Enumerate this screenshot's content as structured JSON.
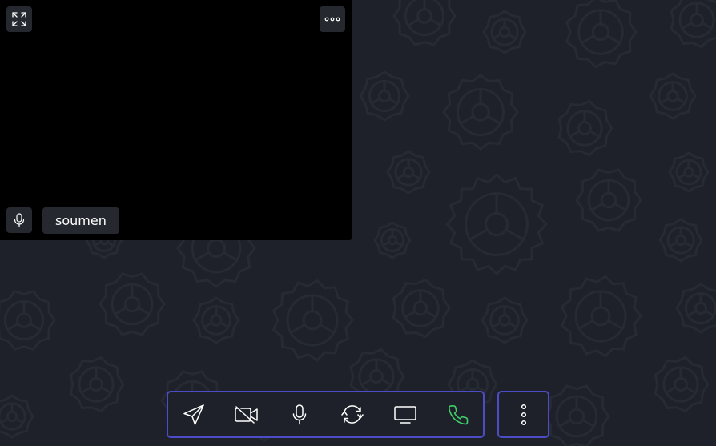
{
  "participant": {
    "name": "soumen"
  },
  "colors": {
    "background": "#1e2129",
    "video_tile": "#000000",
    "button_bg": "#25282e",
    "accent_border": "#4b4cc6",
    "call_green": "#3ecf6a",
    "icon_white": "#ffffff"
  },
  "tile_controls": [
    {
      "icon": "expand-icon"
    },
    {
      "icon": "more-horizontal-icon"
    },
    {
      "icon": "microphone-icon"
    }
  ],
  "toolbar": {
    "buttons": [
      {
        "icon": "send-icon"
      },
      {
        "icon": "video-off-icon"
      },
      {
        "icon": "microphone-icon"
      },
      {
        "icon": "refresh-icon"
      },
      {
        "icon": "screen-share-icon"
      },
      {
        "icon": "phone-icon"
      }
    ],
    "more": {
      "icon": "more-vertical-icon"
    }
  }
}
